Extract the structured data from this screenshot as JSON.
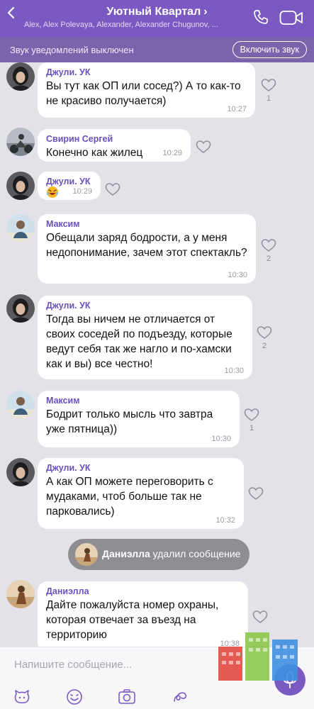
{
  "header": {
    "title": "Уютный Квартал",
    "members": "Alex, Alex Polevaya, Alexander, Alexander Chugunov, ..."
  },
  "mute_bar": {
    "text": "Звук уведомлений выключен",
    "button": "Включить звук"
  },
  "messages": [
    {
      "sender": "Джули. УК",
      "text": "Вы тут как ОП или сосед?) А то как-то не красиво получается)",
      "time": "10:27",
      "likes": "1"
    },
    {
      "sender": "Свирин Сергей",
      "text": "Конечно как жилец",
      "time": "10:29",
      "likes": ""
    },
    {
      "sender": "Джули. УК",
      "text": "",
      "time": "10:29",
      "likes": ""
    },
    {
      "sender": "Максим",
      "text": "Обещали заряд бодрости,  а у меня недопонимание,  зачем этот спектакль?",
      "time": "10:30",
      "likes": "2"
    },
    {
      "sender": "Джули. УК",
      "text": "Тогда вы ничем не отличается от своих соседей по подъезду, которые ведут себя так же нагло и по-хамски как и вы) все честно!",
      "time": "10:30",
      "likes": "2"
    },
    {
      "sender": "Максим",
      "text": "Бодрит только мысль что завтра уже пятница))",
      "time": "10:30",
      "likes": "1"
    },
    {
      "sender": "Джули. УК",
      "text": "А как ОП можете переговорить с мудаками, чтоб больше так не парковались)",
      "time": "10:32",
      "likes": ""
    },
    {
      "sender": "Даниэлла",
      "text": "Дайте пожалуйста номер охраны, которая отвечает за въезд на территорию",
      "time": "10:38",
      "likes": ""
    }
  ],
  "system_message": {
    "name": "Даниэлла",
    "action": "удалил сообщение"
  },
  "input": {
    "placeholder": "Напишите сообщение..."
  },
  "colors": {
    "header": "#7b59c3",
    "mute_bar": "#7a64ac",
    "sender": "#6a4fbf",
    "background": "#e4e2e8"
  },
  "icons": [
    "back-chevron-icon",
    "phone-icon",
    "video-icon",
    "heart-icon",
    "smiley-icon",
    "sticker-icon",
    "gallery-icon",
    "camera-icon",
    "doodle-icon",
    "microphone-icon"
  ]
}
